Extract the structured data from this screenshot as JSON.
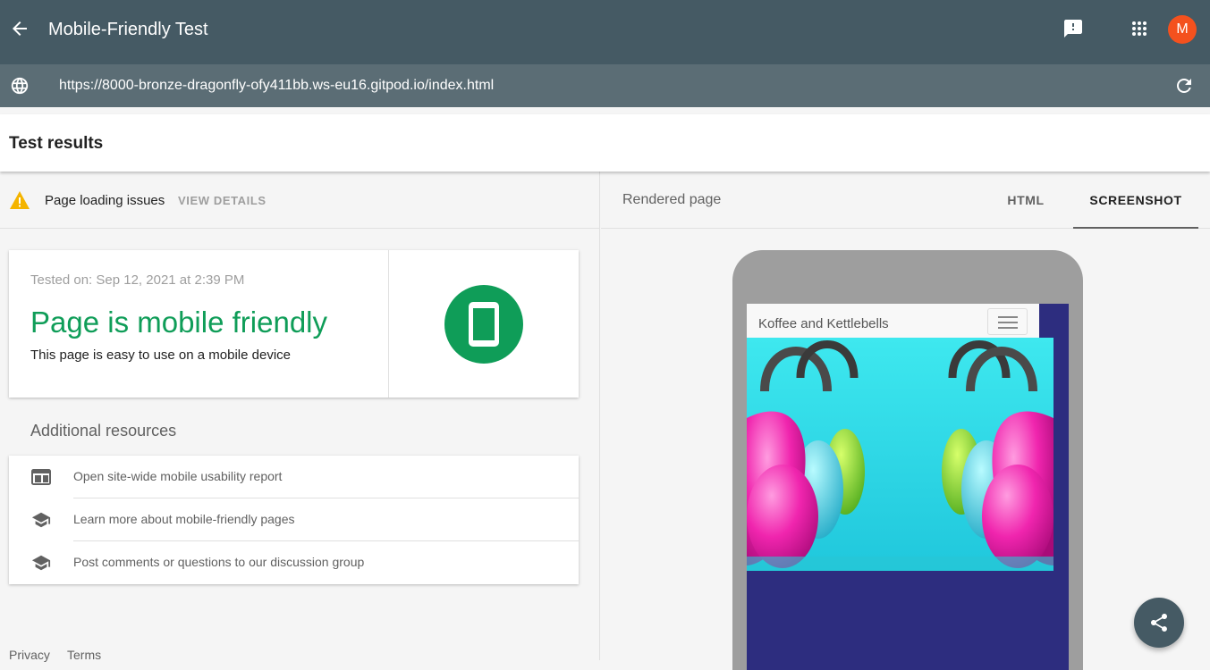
{
  "app": {
    "title": "Mobile-Friendly Test",
    "avatar_letter": "M",
    "icons": {
      "back": "arrow-back-icon",
      "feedback": "feedback-icon",
      "apps": "apps-grid-icon"
    }
  },
  "url_bar": {
    "url": "https://8000-bronze-dragonfly-ofy411bb.ws-eu16.gitpod.io/index.html",
    "icons": {
      "left": "globe-icon",
      "right": "refresh-icon"
    }
  },
  "results": {
    "title": "Test results",
    "issues": {
      "label": "Page loading issues",
      "action": "VIEW DETAILS"
    },
    "summary": {
      "tested_on": "Tested on: Sep 12, 2021 at 2:39 PM",
      "headline": "Page is mobile friendly",
      "description": "This page is easy to use on a mobile device",
      "status_color": "#0f9d58"
    },
    "additional_resources": {
      "title": "Additional resources",
      "items": [
        {
          "label": "Open site-wide mobile usability report",
          "icon": "web-report-icon"
        },
        {
          "label": "Learn more about mobile-friendly pages",
          "icon": "school-cap-icon"
        },
        {
          "label": "Post comments or questions to our discussion group",
          "icon": "school-cap-icon"
        }
      ]
    },
    "footer": {
      "privacy": "Privacy",
      "terms": "Terms"
    }
  },
  "rendered": {
    "title": "Rendered page",
    "tabs": [
      {
        "label": "HTML",
        "selected": false
      },
      {
        "label": "SCREENSHOT",
        "selected": true
      }
    ],
    "site": {
      "brand": "Koffee and Kettlebells",
      "background_color": "#2d2d7f"
    }
  },
  "colors": {
    "app_bar": "#455a64",
    "url_bar": "#5b6d75",
    "accent_green": "#0f9d58",
    "avatar": "#f4511e"
  }
}
